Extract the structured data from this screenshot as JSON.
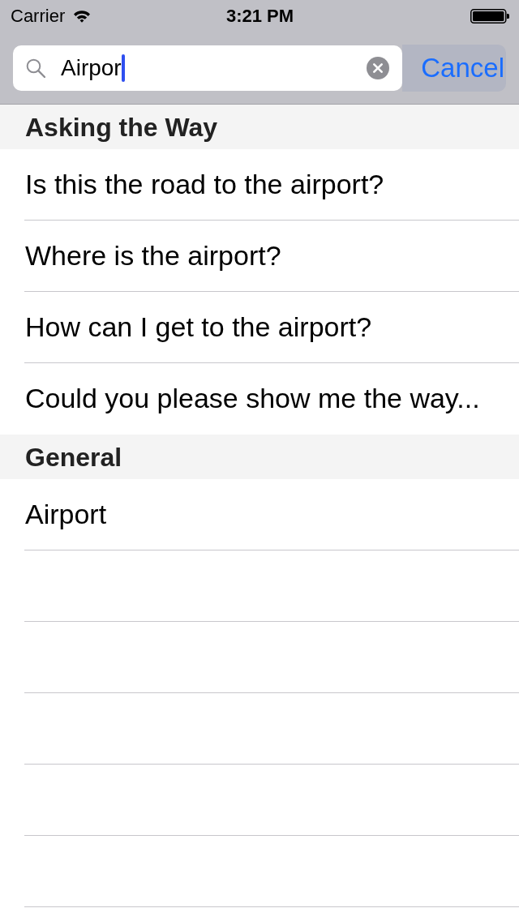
{
  "status_bar": {
    "carrier": "Carrier",
    "time": "3:21 PM"
  },
  "search": {
    "value": "Airpor",
    "focused": true,
    "cancel": "Cancel"
  },
  "sections": [
    {
      "title": "Asking the Way",
      "rows": [
        {
          "text": "Is this the road to the airport?"
        },
        {
          "text": "Where is the airport?"
        },
        {
          "text": "How can I get to the airport?"
        },
        {
          "text": "Could you please show me the way..."
        }
      ]
    },
    {
      "title": "General",
      "rows": [
        {
          "text": "Airport"
        }
      ]
    }
  ]
}
